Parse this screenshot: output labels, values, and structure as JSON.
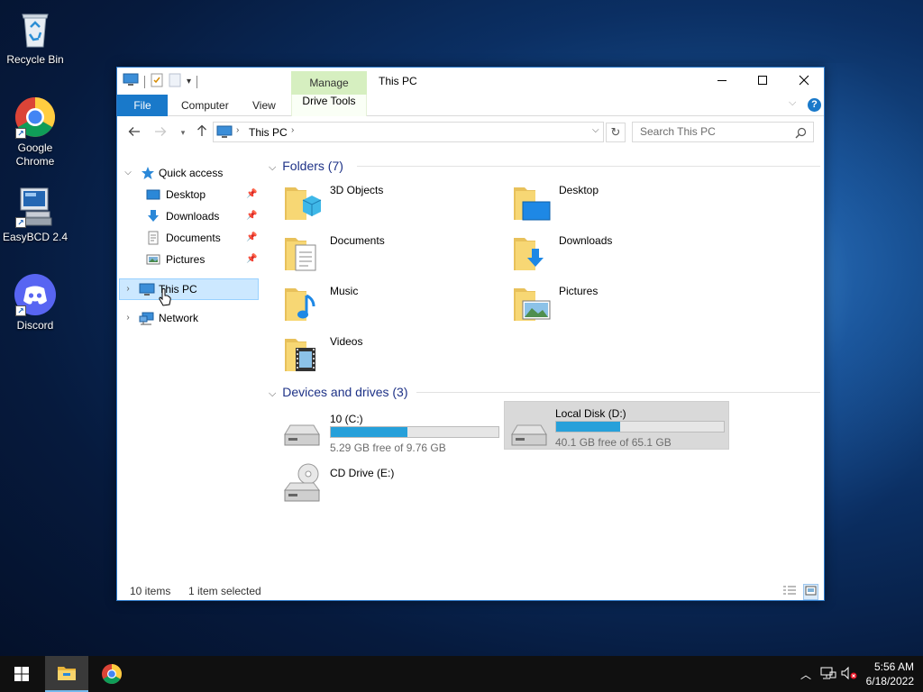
{
  "desktop": {
    "icons": [
      {
        "label": "Recycle Bin",
        "icon": "recycle-bin-icon"
      },
      {
        "label": "Google\nChrome",
        "label_line1": "Google",
        "label_line2": "Chrome",
        "icon": "chrome-icon"
      },
      {
        "label": "EasyBCD 2.4",
        "icon": "easybcd-icon"
      },
      {
        "label": "Discord",
        "icon": "discord-icon"
      }
    ]
  },
  "window": {
    "title": "This PC",
    "manage_tab": "Manage",
    "ribbon": {
      "file": "File",
      "computer": "Computer",
      "view": "View",
      "drive_tools": "Drive Tools"
    },
    "address": {
      "path": "This PC",
      "search_placeholder": "Search This PC"
    },
    "nav": {
      "quick_access": "Quick access",
      "desktop": "Desktop",
      "downloads": "Downloads",
      "documents": "Documents",
      "pictures": "Pictures",
      "this_pc": "This PC",
      "network": "Network"
    },
    "folders_header": "Folders (7)",
    "folders": [
      {
        "name": "3D Objects",
        "icon": "3d-objects-folder-icon"
      },
      {
        "name": "Desktop",
        "icon": "desktop-folder-icon"
      },
      {
        "name": "Documents",
        "icon": "documents-folder-icon"
      },
      {
        "name": "Downloads",
        "icon": "downloads-folder-icon"
      },
      {
        "name": "Music",
        "icon": "music-folder-icon"
      },
      {
        "name": "Pictures",
        "icon": "pictures-folder-icon"
      },
      {
        "name": "Videos",
        "icon": "videos-folder-icon"
      }
    ],
    "drives_header": "Devices and drives (3)",
    "drives": [
      {
        "name": "10 (C:)",
        "free": "5.29 GB free of 9.76 GB",
        "used_fraction": 0.458
      },
      {
        "name": "Local Disk (D:)",
        "free": "40.1 GB free of 65.1 GB",
        "used_fraction": 0.384
      },
      {
        "name": "CD Drive (E:)"
      }
    ],
    "status": {
      "items": "10 items",
      "selected": "1 item selected"
    }
  },
  "taskbar": {
    "time": "5:56 AM",
    "date": "6/18/2022"
  },
  "colors": {
    "accent": "#1979ca",
    "manage_tab_bg": "#d6efc0",
    "selection": "#cce8ff",
    "drive_bar": "#26a0da"
  }
}
